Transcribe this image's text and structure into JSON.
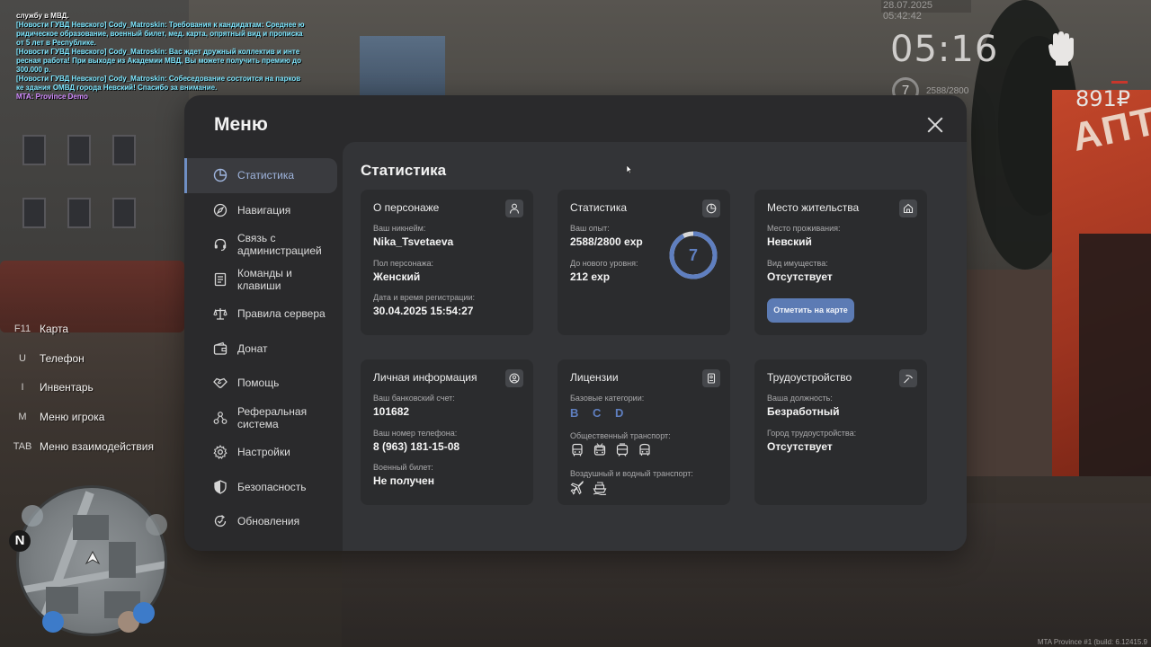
{
  "chat": [
    {
      "text": " службу в МВД.",
      "color": "#f2f2f2"
    },
    {
      "text": "[Новости ГУВД Невского] Cody_Matroskin: Требования к кандидатам: Среднее ю",
      "color": "#7fe7ff"
    },
    {
      "text": "ридическое образование, военный билет, мед. карта, опрятный вид и прописка",
      "color": "#7fe7ff"
    },
    {
      "text": " от 5 лет в Республике.",
      "color": "#7fe7ff"
    },
    {
      "text": "[Новости ГУВД Невского] Cody_Matroskin: Вас ждет дружный коллектив и инте",
      "color": "#7fe7ff"
    },
    {
      "text": "ресная работа! При выходе из Академии МВД, Вы можете получить премию до",
      "color": "#7fe7ff"
    },
    {
      "text": " 300.000 р.",
      "color": "#7fe7ff"
    },
    {
      "text": "[Новости ГУВД Невского] Cody_Matroskin: Собеседование состоится на парков",
      "color": "#7fe7ff"
    },
    {
      "text": "ке здания ОМВД города Невский! Спасибо за внимание.",
      "color": "#7fe7ff"
    },
    {
      "text": "MTA: Province Demo",
      "color": "#d28cff"
    }
  ],
  "hud": {
    "datetime": "28.07.2025 05:42:42",
    "time": "05:16",
    "level": "7",
    "exp": "2588/2800",
    "money": "891₽"
  },
  "hints": [
    {
      "key": "F11",
      "label": "Карта"
    },
    {
      "key": "U",
      "label": "Телефон"
    },
    {
      "key": "I",
      "label": "Инвентарь"
    },
    {
      "key": "M",
      "label": "Меню игрока"
    },
    {
      "key": "TAB",
      "label": "Меню взаимодействия"
    }
  ],
  "minimap": {
    "north": "N"
  },
  "menu": {
    "title": "Меню",
    "nav": [
      {
        "label": "Статистика",
        "icon": "pie-chart-icon",
        "active": true
      },
      {
        "label": "Навигация",
        "icon": "compass-icon"
      },
      {
        "label": "Связь с\nадминистрацией",
        "icon": "headset-icon"
      },
      {
        "label": "Команды и\nклавиши",
        "icon": "document-icon"
      },
      {
        "label": "Правила сервера",
        "icon": "scales-icon"
      },
      {
        "label": "Донат",
        "icon": "wallet-icon"
      },
      {
        "label": "Помощь",
        "icon": "handshake-icon"
      },
      {
        "label": "Реферальная\nсистема",
        "icon": "referral-icon"
      },
      {
        "label": "Настройки",
        "icon": "gear-icon"
      },
      {
        "label": "Безопасность",
        "icon": "shield-icon"
      },
      {
        "label": "Обновления",
        "icon": "refresh-check-icon"
      }
    ],
    "panel_title": "Статистика",
    "cards": {
      "character": {
        "title": "О персонаже",
        "icon": "user-icon",
        "nickname_label": "Ваш никнейм:",
        "nickname": "Nika_Tsvetaeva",
        "gender_label": "Пол персонажа:",
        "gender": "Женский",
        "reg_label": "Дата и время регистрации:",
        "reg": "30.04.2025 15:54:27"
      },
      "stats": {
        "title": "Статистика",
        "icon": "clock-pie-icon",
        "exp_label": "Ваш опыт:",
        "exp": "2588/2800 exp",
        "next_label": "До нового уровня:",
        "next": "212 exp",
        "level": "7",
        "progress": 0.924
      },
      "residence": {
        "title": "Место жительства",
        "icon": "house-icon",
        "place_label": "Место проживания:",
        "place": "Невский",
        "property_label": "Вид имущества:",
        "property": "Отсутствует",
        "button": "Отметить на карте"
      },
      "personal": {
        "title": "Личная информация",
        "icon": "user-circle-icon",
        "bank_label": "Ваш банковский счет:",
        "bank": "101682",
        "phone_label": "Ваш номер телефона:",
        "phone": "8 (963) 181-15-08",
        "military_label": "Военный билет:",
        "military": "Не получен"
      },
      "licenses": {
        "title": "Лицензии",
        "icon": "id-card-icon",
        "base_label": "Базовые категории:",
        "base": "B C D",
        "public_label": "Общественный транспорт:",
        "public_icons": [
          "bus-icon",
          "trolleybus-icon",
          "tram-icon",
          "minibus-icon"
        ],
        "air_label": "Воздушный и водный транспорт:",
        "air_icons": [
          "plane-icon",
          "boat-icon"
        ]
      },
      "job": {
        "title": "Трудоустройство",
        "icon": "pickaxe-icon",
        "position_label": "Ваша должность:",
        "position": "Безработный",
        "city_label": "Город трудоустройства:",
        "city": "Отсутствует"
      }
    }
  },
  "world": {
    "pharmacy_sign": "АПТЕКА"
  },
  "build": "MTA Province #1 (build: 6.12415.9",
  "colors": {
    "accent": "#5f7fc0",
    "button": "#5c7bb4",
    "panel": "#333437",
    "card": "#2b2c2e"
  }
}
